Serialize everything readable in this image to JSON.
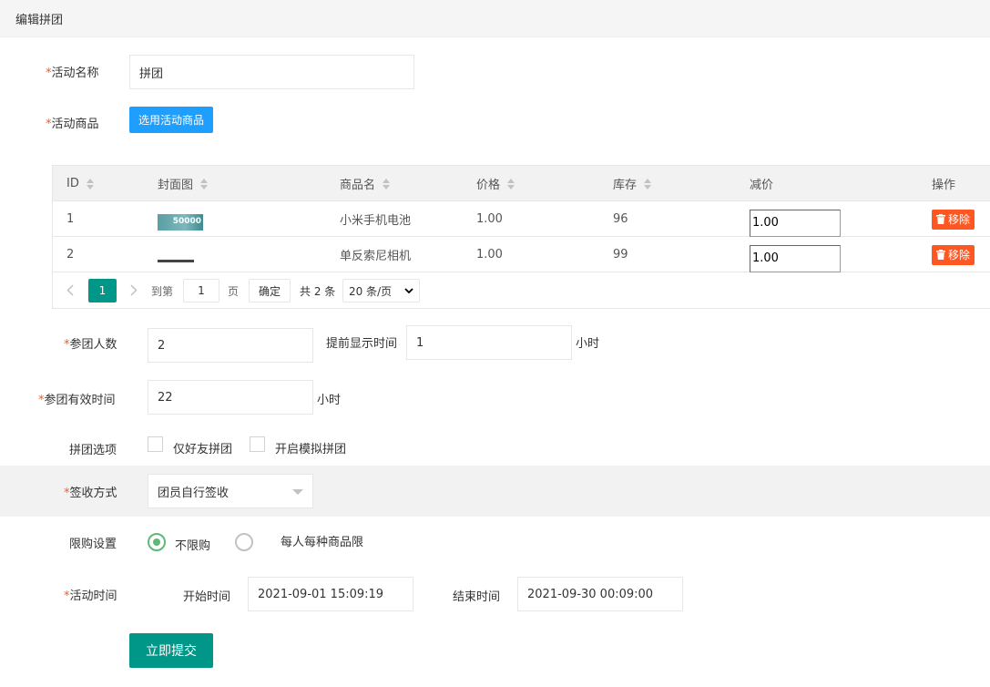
{
  "header": {
    "title": "编辑拼团"
  },
  "form": {
    "required_mark": "*",
    "activity_name": {
      "label": "活动名称",
      "value": "拼团"
    },
    "activity_goods": {
      "label": "活动商品",
      "button": "选用活动商品"
    },
    "group_size": {
      "label": "参团人数",
      "value": "2"
    },
    "advance_show": {
      "label": "提前显示时间",
      "value": "1",
      "unit": "小时"
    },
    "valid_time": {
      "label": "参团有效时间",
      "value": "22",
      "unit": "小时"
    },
    "group_options": {
      "label": "拼团选项",
      "opt1": "仅好友拼团",
      "opt2": "开启模拟拼团"
    },
    "receipt": {
      "label": "签收方式",
      "value": "团员自行签收"
    },
    "limit": {
      "label": "限购设置",
      "opt1": "不限购",
      "opt2": "每人每种商品限"
    },
    "activity_time": {
      "label": "活动时间",
      "start_label": "开始时间",
      "start": "2021-09-01 15:09:19",
      "end_label": "结束时间",
      "end": "2021-09-30 00:09:00"
    },
    "submit": "立即提交"
  },
  "table": {
    "columns": [
      "ID",
      "封面图",
      "商品名",
      "价格",
      "库存",
      "减价",
      "操作"
    ],
    "rows": [
      {
        "id": "1",
        "cover_text": "50000",
        "name": "小米手机电池",
        "price": "1.00",
        "stock": "96",
        "cut": "1.00",
        "action": "移除"
      },
      {
        "id": "2",
        "cover_text": "",
        "name": "单反索尼相机",
        "price": "1.00",
        "stock": "99",
        "cut": "1.00",
        "action": "移除"
      }
    ],
    "pager": {
      "current": "1",
      "goto_label": "到第",
      "goto_value": "1",
      "page_label": "页",
      "confirm": "确定",
      "total": "共 2 条",
      "per_page": "20 条/页"
    }
  },
  "colors": {
    "teal": "#009688",
    "blue": "#1e9fff",
    "danger": "#ff5722",
    "radio": "#5fb878"
  },
  "icons": {
    "delete": "trash-icon",
    "prev": "chevron-left-icon",
    "next": "chevron-right-icon",
    "select": "caret-down-icon"
  }
}
